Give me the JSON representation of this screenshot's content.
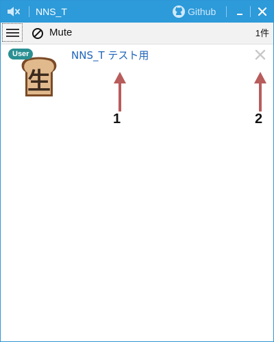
{
  "titlebar": {
    "title": "NNS_T",
    "github_label": "Github",
    "icons": [
      "speaker-muted-icon",
      "github-icon",
      "minimize-icon",
      "close-icon"
    ]
  },
  "toolbar": {
    "mute_label": "Mute",
    "count_label": "1件",
    "icons": [
      "hamburger-menu-icon",
      "prohibited-icon"
    ]
  },
  "items": [
    {
      "badge": "User",
      "title": "NNS_T テスト用",
      "avatar_char": "生",
      "icons": [
        "bread-avatar-icon",
        "remove-x-icon"
      ]
    }
  ],
  "annotations": [
    {
      "number": "1",
      "points_to": "item-title"
    },
    {
      "number": "2",
      "points_to": "item-remove"
    }
  ],
  "colors": {
    "titlebar": "#2d9ad9",
    "badge": "#2a8f92",
    "link": "#1e63b8",
    "arrow": "#b85c5c"
  }
}
